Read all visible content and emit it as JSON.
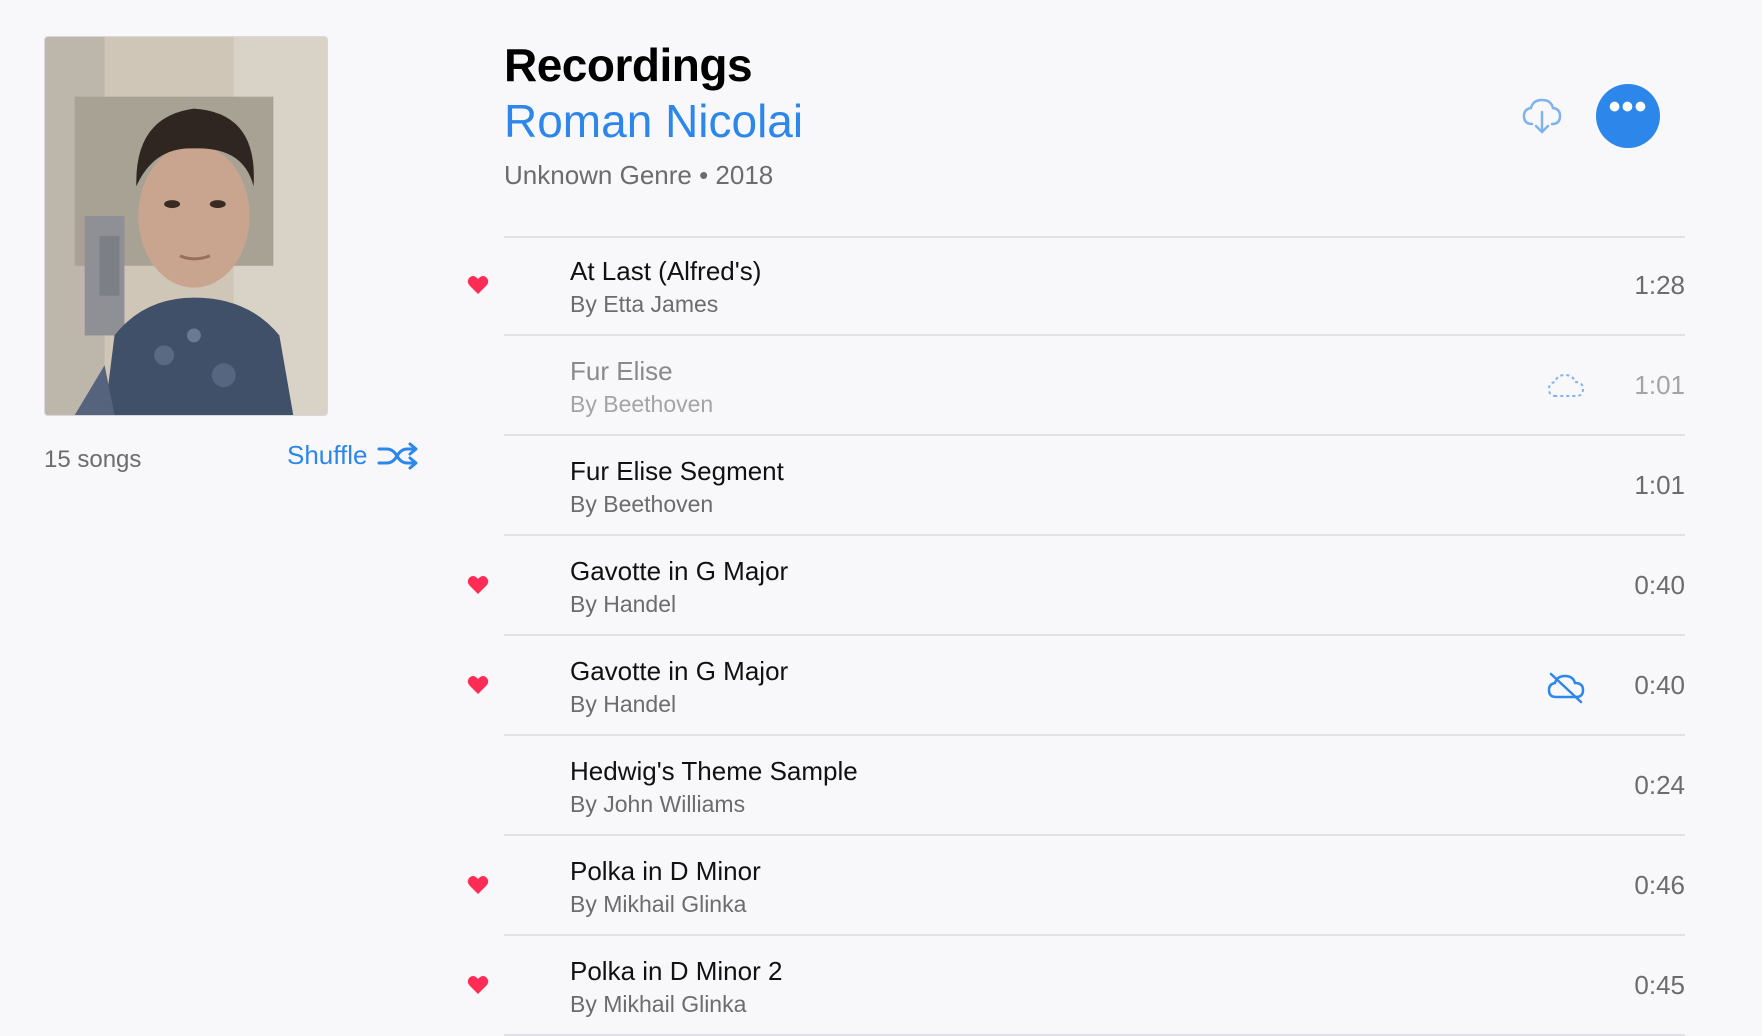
{
  "header": {
    "title": "Recordings",
    "artist": "Roman Nicolai",
    "meta": "Unknown Genre • 2018",
    "more_glyph": "•••"
  },
  "sidebar": {
    "song_count": "15 songs",
    "shuffle_label": "Shuffle"
  },
  "colors": {
    "accent": "#2d87ea",
    "heart": "#ff2d55",
    "background": "#f8f8fa"
  },
  "icons": {
    "download": "cloud-download-icon",
    "more": "more-icon",
    "shuffle": "shuffle-icon",
    "heart": "heart-icon",
    "cloud_outline": "cloud-outline-icon",
    "cloud_offline": "cloud-offline-icon"
  },
  "songs": [
    {
      "title": "At Last (Alfred's)",
      "artist": "By Etta James",
      "duration": "1:28",
      "loved": true,
      "cloud": "none",
      "dimmed": false
    },
    {
      "title": "Fur Elise",
      "artist": "By Beethoven",
      "duration": "1:01",
      "loved": false,
      "cloud": "outline",
      "dimmed": true
    },
    {
      "title": "Fur Elise Segment",
      "artist": "By Beethoven",
      "duration": "1:01",
      "loved": false,
      "cloud": "none",
      "dimmed": false
    },
    {
      "title": "Gavotte in G Major",
      "artist": "By Handel",
      "duration": "0:40",
      "loved": true,
      "cloud": "none",
      "dimmed": false
    },
    {
      "title": "Gavotte in G Major",
      "artist": "By Handel",
      "duration": "0:40",
      "loved": true,
      "cloud": "offline",
      "dimmed": false
    },
    {
      "title": "Hedwig's Theme Sample",
      "artist": "By John Williams",
      "duration": "0:24",
      "loved": false,
      "cloud": "none",
      "dimmed": false
    },
    {
      "title": "Polka in D Minor",
      "artist": "By Mikhail Glinka",
      "duration": "0:46",
      "loved": true,
      "cloud": "none",
      "dimmed": false
    },
    {
      "title": "Polka in D Minor 2",
      "artist": "By Mikhail Glinka",
      "duration": "0:45",
      "loved": true,
      "cloud": "none",
      "dimmed": false
    }
  ]
}
